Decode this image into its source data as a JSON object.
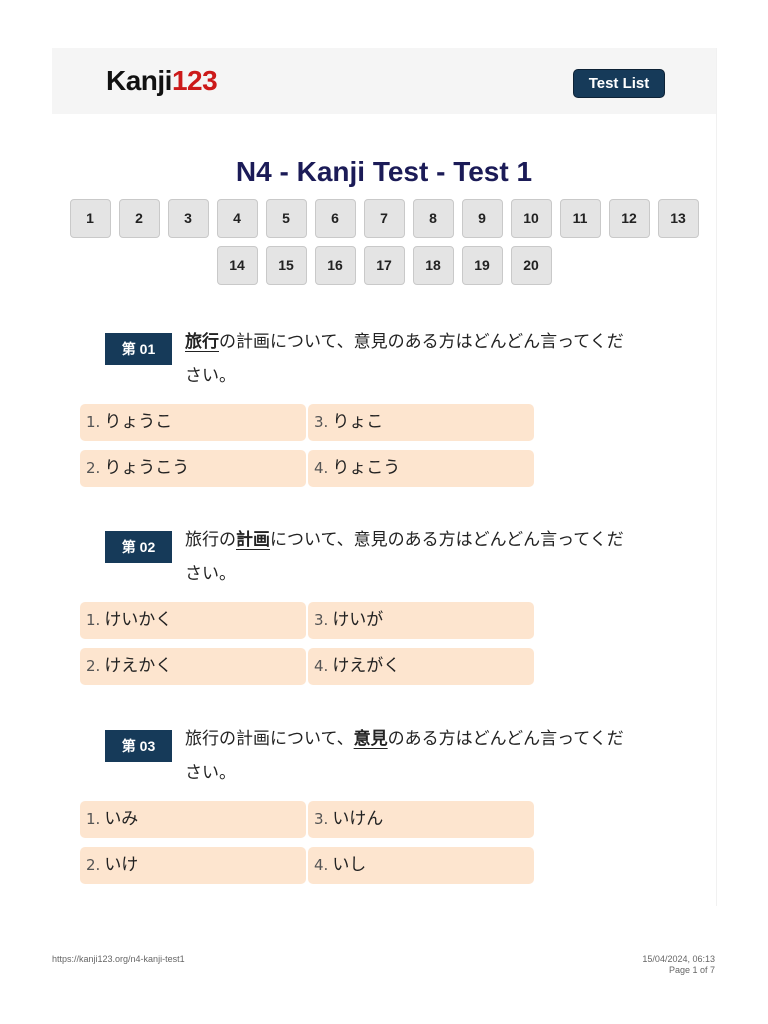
{
  "header": {
    "logo_part1": "Kanji",
    "logo_part2": "123",
    "test_list_label": "Test List"
  },
  "page_title": "N4 - Kanji Test - Test 1",
  "pages": [
    "1",
    "2",
    "3",
    "4",
    "5",
    "6",
    "7",
    "8",
    "9",
    "10",
    "11",
    "12",
    "13",
    "14",
    "15",
    "16",
    "17",
    "18",
    "19",
    "20"
  ],
  "questions": [
    {
      "number": "第 01",
      "sentence_before": "",
      "highlight": "旅行",
      "sentence_after": "の計画について、意見のある方はどんどん言ってください。",
      "options": [
        "りょうこ",
        "りょうこう",
        "りょこ",
        "りょこう"
      ]
    },
    {
      "number": "第 02",
      "sentence_before": "旅行の",
      "highlight": "計画",
      "sentence_after": "について、意見のある方はどんどん言ってください。",
      "options": [
        "けいかく",
        "けえかく",
        "けいが",
        "けえがく"
      ]
    },
    {
      "number": "第 03",
      "sentence_before": "旅行の計画について、",
      "highlight": "意見",
      "sentence_after": "のある方はどんどん言ってください。",
      "options": [
        "いみ",
        "いけ",
        "いけん",
        "いし"
      ]
    }
  ],
  "footer": {
    "url": "https://kanji123.org/n4-kanji-test1",
    "datetime": "15/04/2024, 06:13",
    "page_info": "Page 1 of 7"
  }
}
